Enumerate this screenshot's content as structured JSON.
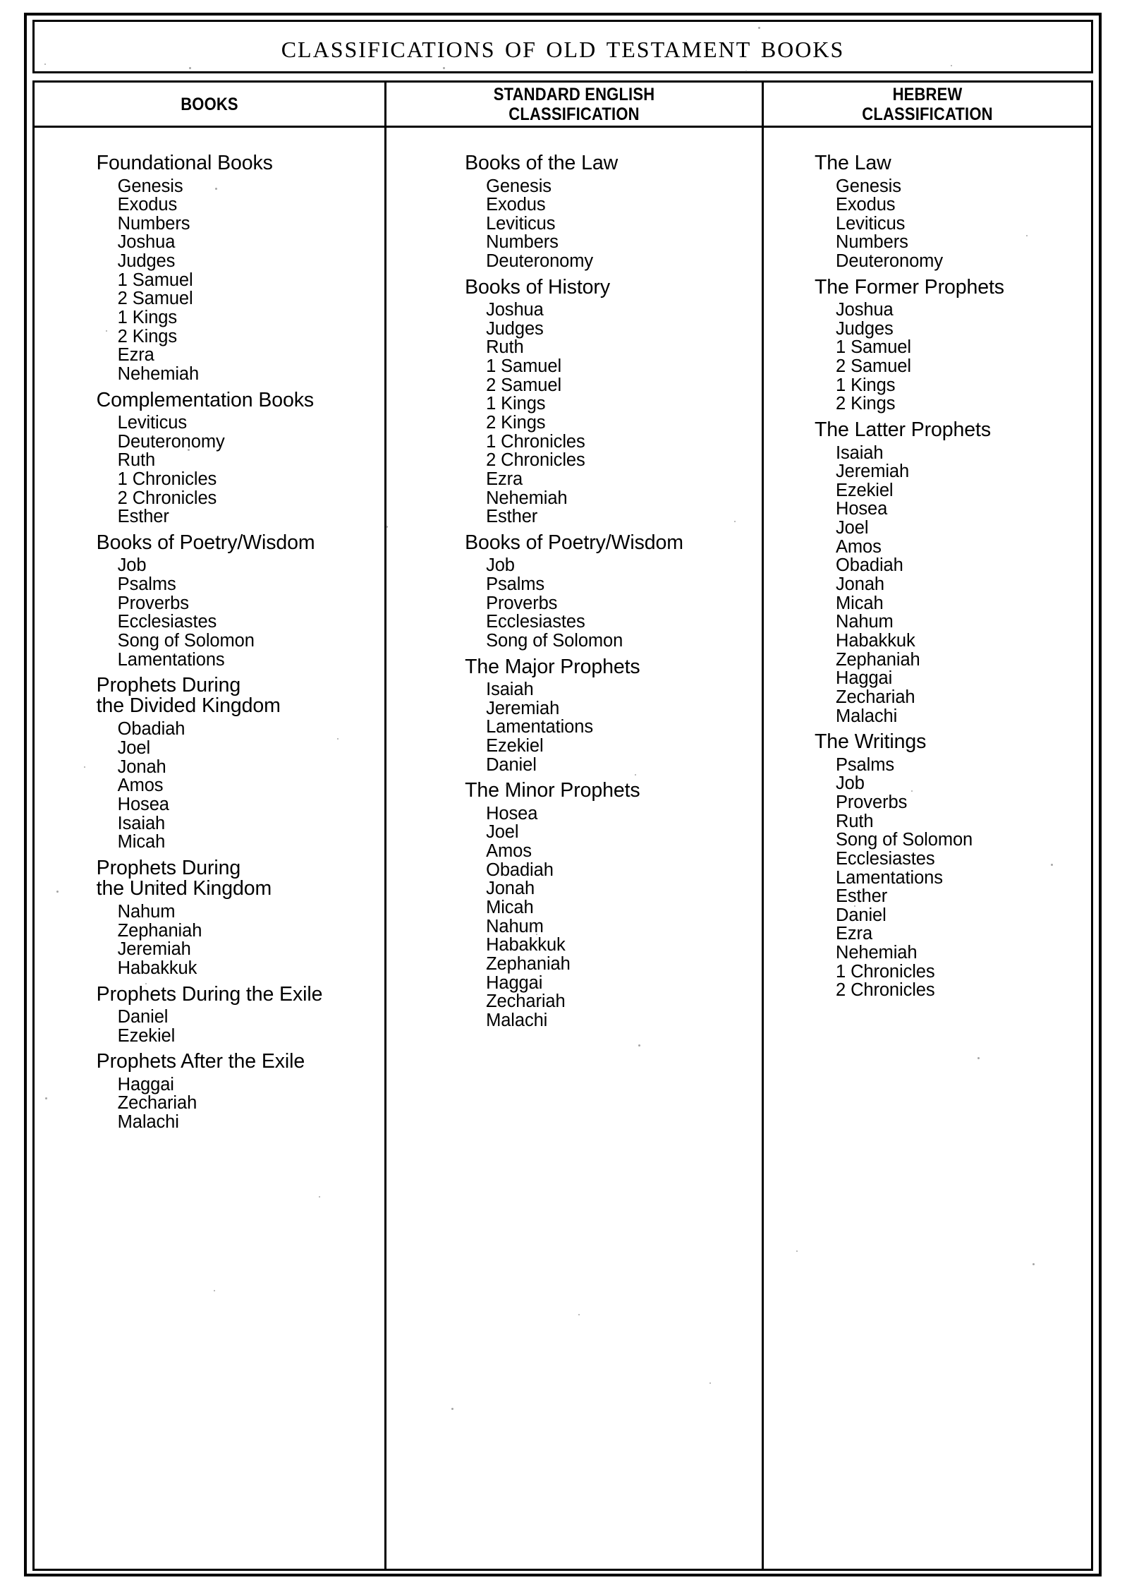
{
  "document": {
    "title": "Classifications of Old Testament Books"
  },
  "table": {
    "headers": [
      "BOOKS",
      "STANDARD ENGLISH\nCLASSIFICATION",
      "HEBREW\nCLASSIFICATION"
    ],
    "columns": [
      {
        "header": "BOOKS",
        "groups": [
          {
            "heading": "Foundational Books",
            "books": [
              "Genesis",
              "Exodus",
              "Numbers",
              "Joshua",
              "Judges",
              "1 Samuel",
              "2 Samuel",
              "1 Kings",
              "2 Kings",
              "Ezra",
              "Nehemiah"
            ]
          },
          {
            "heading": "Complementation Books",
            "books": [
              "Leviticus",
              "Deuteronomy",
              "Ruth",
              "1 Chronicles",
              "2 Chronicles",
              "Esther"
            ]
          },
          {
            "heading": "Books of Poetry/Wisdom",
            "books": [
              "Job",
              "Psalms",
              "Proverbs",
              "Ecclesiastes",
              "Song of Solomon",
              "Lamentations"
            ]
          },
          {
            "heading": "Prophets During\nthe Divided Kingdom",
            "books": [
              "Obadiah",
              "Joel",
              "Jonah",
              "Amos",
              "Hosea",
              "Isaiah",
              "Micah"
            ]
          },
          {
            "heading": "Prophets During\nthe United Kingdom",
            "books": [
              "Nahum",
              "Zephaniah",
              "Jeremiah",
              "Habakkuk"
            ]
          },
          {
            "heading": "Prophets During the Exile",
            "books": [
              "Daniel",
              "Ezekiel"
            ]
          },
          {
            "heading": "Prophets After the Exile",
            "books": [
              "Haggai",
              "Zechariah",
              "Malachi"
            ]
          }
        ]
      },
      {
        "header": "STANDARD ENGLISH CLASSIFICATION",
        "groups": [
          {
            "heading": "Books of the Law",
            "books": [
              "Genesis",
              "Exodus",
              "Leviticus",
              "Numbers",
              "Deuteronomy"
            ]
          },
          {
            "heading": "Books of History",
            "books": [
              "Joshua",
              "Judges",
              "Ruth",
              "1 Samuel",
              "2 Samuel",
              "1 Kings",
              "2 Kings",
              "1 Chronicles",
              "2 Chronicles",
              "Ezra",
              "Nehemiah",
              "Esther"
            ]
          },
          {
            "heading": "Books of Poetry/Wisdom",
            "books": [
              "Job",
              "Psalms",
              "Proverbs",
              "Ecclesiastes",
              "Song of Solomon"
            ]
          },
          {
            "heading": "The Major Prophets",
            "books": [
              "Isaiah",
              "Jeremiah",
              "Lamentations",
              "Ezekiel",
              "Daniel"
            ]
          },
          {
            "heading": "The Minor Prophets",
            "books": [
              "Hosea",
              "Joel",
              "Amos",
              "Obadiah",
              "Jonah",
              "Micah",
              "Nahum",
              "Habakkuk",
              "Zephaniah",
              "Haggai",
              "Zechariah",
              "Malachi"
            ]
          }
        ]
      },
      {
        "header": "HEBREW CLASSIFICATION",
        "groups": [
          {
            "heading": "The Law",
            "books": [
              "Genesis",
              "Exodus",
              "Leviticus",
              "Numbers",
              "Deuteronomy"
            ]
          },
          {
            "heading": "The Former Prophets",
            "books": [
              "Joshua",
              "Judges",
              "1 Samuel",
              "2 Samuel",
              "1 Kings",
              "2 Kings"
            ]
          },
          {
            "heading": "The Latter Prophets",
            "books": [
              "Isaiah",
              "Jeremiah",
              "Ezekiel",
              "Hosea",
              "Joel",
              "Amos",
              "Obadiah",
              "Jonah",
              "Micah",
              "Nahum",
              "Habakkuk",
              "Zephaniah",
              "Haggai",
              "Zechariah",
              "Malachi"
            ]
          },
          {
            "heading": "The Writings",
            "books": [
              "Psalms",
              "Job",
              "Proverbs",
              "Ruth",
              "Song of Solomon",
              "Ecclesiastes",
              "Lamentations",
              "Esther",
              "Daniel",
              "Ezra",
              "Nehemiah",
              "1 Chronicles",
              "2 Chronicles"
            ]
          }
        ]
      }
    ]
  }
}
